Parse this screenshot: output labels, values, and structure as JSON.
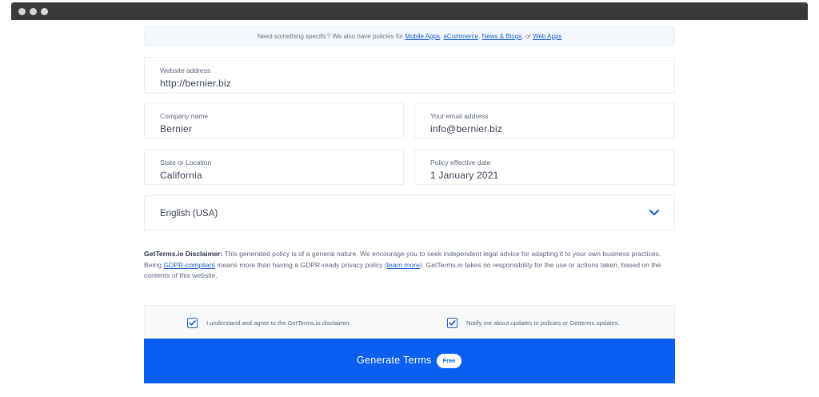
{
  "notice": {
    "prefix": "Need something specific? We also have policies for ",
    "links": [
      "Mobile Apps",
      "eCommerce",
      "News & Blogs",
      "Web Apps"
    ],
    "sep1": ", ",
    "sep2": ", ",
    "sep3": ", or "
  },
  "form": {
    "website": {
      "label": "Website address",
      "value": "http://bernier.biz"
    },
    "company": {
      "label": "Company name",
      "value": "Bernier"
    },
    "email": {
      "label": "Your email address",
      "value": "info@bernier.biz"
    },
    "state": {
      "label": "State or Location",
      "value": "California"
    },
    "date": {
      "label": "Policy effective date",
      "value": "1 January 2021"
    },
    "language": {
      "value": "English (USA)",
      "icon": "chevron-down-icon"
    }
  },
  "disclaimer": {
    "title": "GetTerms.io Disclaimer:",
    "text1": " This generated policy is of a general nature. We encourage you to seek independent legal advice for adapting it to your own business practices. Being ",
    "link1": "GDPR-compliant",
    "text2": " means more than having a GDPR-ready privacy policy (",
    "link2": "learn more",
    "text3": "). GetTerms.io takes no responsibility for the use or actions taken, based on the contents of this website."
  },
  "consent": {
    "agree_label": "I understand and agree to the GetTerms.io disclaimer.",
    "agree_checked": true,
    "notify_label": "Notify me about updates to policies or Getterms updates.",
    "notify_checked": true
  },
  "generate": {
    "label": "Generate Terms",
    "badge": "Free"
  },
  "colors": {
    "accent": "#0a5ff0",
    "link": "#1d5fd1"
  }
}
